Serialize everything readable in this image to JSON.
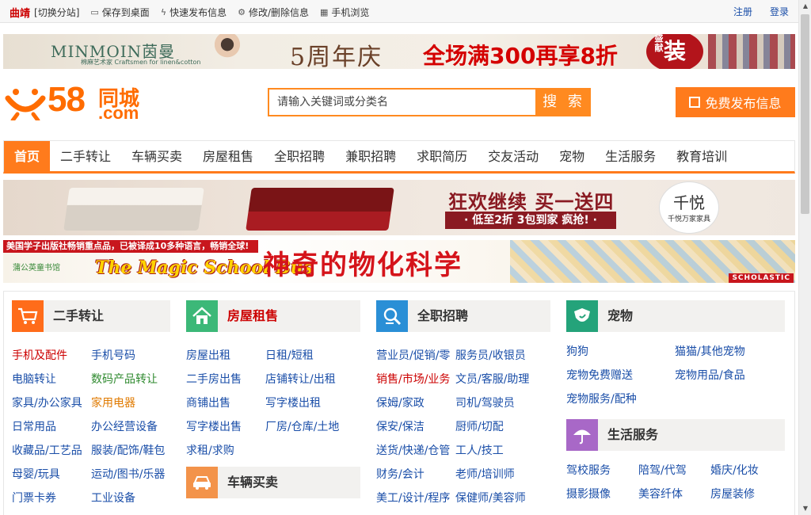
{
  "topbar": {
    "city": "曲靖",
    "switch": "[切换分站]",
    "links": [
      {
        "icon": "desktop-icon",
        "label": "保存到桌面"
      },
      {
        "icon": "lightning-icon",
        "label": "快速发布信息"
      },
      {
        "icon": "gear-icon",
        "label": "修改/删除信息"
      },
      {
        "icon": "qrcode-icon",
        "label": "手机浏览"
      }
    ],
    "register": "注册",
    "login": "登录"
  },
  "banner_top": {
    "brand": "MINMOIN茵曼",
    "brand_cn": "棉麻艺术家",
    "brand_en": "Craftsmen for linen&cotton",
    "anniversary": "5周年庆",
    "promo": "全场满300再享8折",
    "seal": "装",
    "seal_small": "盛献"
  },
  "header": {
    "logo_num": "58",
    "logo_cn": "同城",
    "logo_com": ".com",
    "search_placeholder": "请输入关键词或分类名",
    "search_button": "搜 索",
    "publish_button": "免费发布信息"
  },
  "nav": {
    "items": [
      "首页",
      "二手转让",
      "车辆买卖",
      "房屋租售",
      "全职招聘",
      "兼职招聘",
      "求职简历",
      "交友活动",
      "宠物",
      "生活服务",
      "教育培训"
    ]
  },
  "banner_furniture": {
    "headline": "狂欢继续 买一送四",
    "sub": "· 低至2折 3包到家 疯抢! ·",
    "brand": "千悦",
    "brand_sub": "千悦万家家具"
  },
  "banner_books": {
    "topline": "美国学子出版社畅销重点品，已被译成10多种语言，畅销全球!",
    "publisher": "蒲公英童书馆",
    "series": "The Magic School Bus",
    "title": "神奇的物化科学",
    "scholastic": "SCHOLASTIC"
  },
  "categories": {
    "secondhand": {
      "title": "二手转让",
      "color": "#ff6c1a",
      "rows": [
        [
          {
            "t": "手机及配件",
            "c": "red"
          },
          {
            "t": "手机号码",
            "c": ""
          }
        ],
        [
          {
            "t": "电脑转让",
            "c": ""
          },
          {
            "t": "数码产品转让",
            "c": "green"
          }
        ],
        [
          {
            "t": "家具/办公家具",
            "c": ""
          },
          {
            "t": "家用电器",
            "c": "orange"
          }
        ],
        [
          {
            "t": "日常用品",
            "c": ""
          },
          {
            "t": "办公经营设备",
            "c": ""
          }
        ],
        [
          {
            "t": "收藏品/工艺品",
            "c": ""
          },
          {
            "t": "服装/配饰/鞋包",
            "c": ""
          }
        ],
        [
          {
            "t": "母婴/玩具",
            "c": ""
          },
          {
            "t": "运动/图书/乐器",
            "c": ""
          }
        ],
        [
          {
            "t": "门票卡券",
            "c": ""
          },
          {
            "t": "工业设备",
            "c": ""
          }
        ]
      ]
    },
    "housing": {
      "title": "房屋租售",
      "color": "#3cb878",
      "rows": [
        [
          {
            "t": "房屋出租",
            "c": ""
          },
          {
            "t": "日租/短租",
            "c": ""
          }
        ],
        [
          {
            "t": "二手房出售",
            "c": ""
          },
          {
            "t": "店铺转让/出租",
            "c": ""
          }
        ],
        [
          {
            "t": "商铺出售",
            "c": ""
          },
          {
            "t": "写字楼出租",
            "c": ""
          }
        ],
        [
          {
            "t": "写字楼出售",
            "c": ""
          },
          {
            "t": "厂房/仓库/土地",
            "c": ""
          }
        ],
        [
          {
            "t": "求租/求购",
            "c": ""
          }
        ]
      ]
    },
    "vehicles": {
      "title": "车辆买卖",
      "color": "#f3934a"
    },
    "jobs": {
      "title": "全职招聘",
      "color": "#2a8fd6",
      "rows": [
        [
          {
            "t": "营业员/促销/零",
            "c": ""
          },
          {
            "t": "服务员/收银员",
            "c": ""
          }
        ],
        [
          {
            "t": "销售/市场/业务",
            "c": "red"
          },
          {
            "t": "文员/客服/助理",
            "c": ""
          }
        ],
        [
          {
            "t": "保姆/家政",
            "c": ""
          },
          {
            "t": "司机/驾驶员",
            "c": ""
          }
        ],
        [
          {
            "t": "保安/保洁",
            "c": ""
          },
          {
            "t": "厨师/切配",
            "c": ""
          }
        ],
        [
          {
            "t": "送货/快递/仓管",
            "c": ""
          },
          {
            "t": "工人/技工",
            "c": ""
          }
        ],
        [
          {
            "t": "财务/会计",
            "c": ""
          },
          {
            "t": "老师/培训师",
            "c": ""
          }
        ],
        [
          {
            "t": "美工/设计/程序",
            "c": ""
          },
          {
            "t": "保健师/美容师",
            "c": ""
          }
        ]
      ]
    },
    "pets": {
      "title": "宠物",
      "color": "#24a37a",
      "rows": [
        [
          {
            "t": "狗狗",
            "c": ""
          },
          {
            "t": "猫猫/其他宠物",
            "c": ""
          }
        ],
        [
          {
            "t": "宠物免费赠送",
            "c": ""
          },
          {
            "t": "宠物用品/食品",
            "c": ""
          }
        ],
        [
          {
            "t": "宠物服务/配种",
            "c": ""
          }
        ]
      ]
    },
    "life": {
      "title": "生活服务",
      "color": "#a868c7",
      "rows": [
        [
          {
            "t": "驾校服务",
            "c": ""
          },
          {
            "t": "陪驾/代驾",
            "c": ""
          },
          {
            "t": "婚庆/化妆",
            "c": ""
          }
        ],
        [
          {
            "t": "摄影摄像",
            "c": ""
          },
          {
            "t": "美容纤体",
            "c": ""
          },
          {
            "t": "房屋装修",
            "c": ""
          }
        ]
      ]
    }
  }
}
